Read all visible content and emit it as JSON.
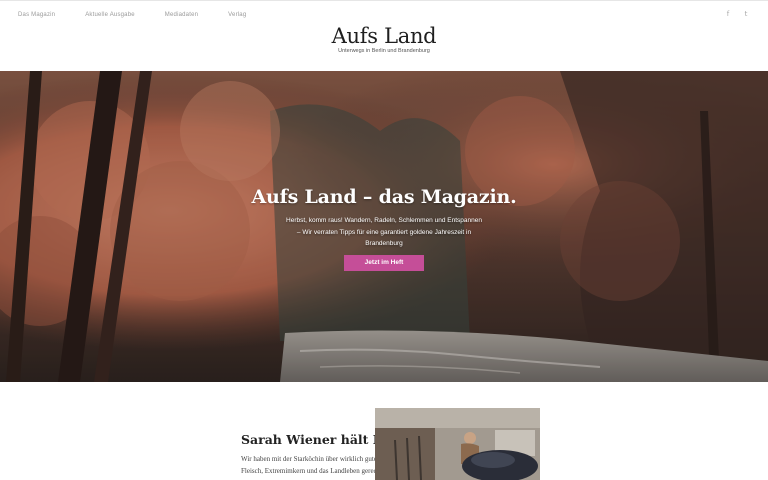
{
  "nav": {
    "items": [
      {
        "label": "Das Magazin"
      },
      {
        "label": "Aktuelle Ausgabe"
      },
      {
        "label": "Mediadaten"
      },
      {
        "label": "Verlag"
      }
    ]
  },
  "brand": {
    "title": "Aufs Land",
    "tagline": "Unterwegs in Berlin und Brandenburg"
  },
  "social": {
    "facebook_glyph": "f",
    "twitter_glyph": "t",
    "icon_color": "#a9a9a9"
  },
  "hero": {
    "title": "Aufs Land – das Magazin.",
    "text": "Herbst, komm raus! Wandern, Radeln, Schlemmen und Entspannen – Wir verraten Tipps für eine garantiert goldene Jahreszeit in Brandenburg",
    "cta_label": "Jetzt im Heft",
    "cta_color": "#c54e98"
  },
  "teaser": {
    "title": "Sarah Wiener hält Hof",
    "text": "Wir haben mit der Starköchin über wirklich gutes Fleisch, Extremimkern und das Landleben geredet"
  }
}
